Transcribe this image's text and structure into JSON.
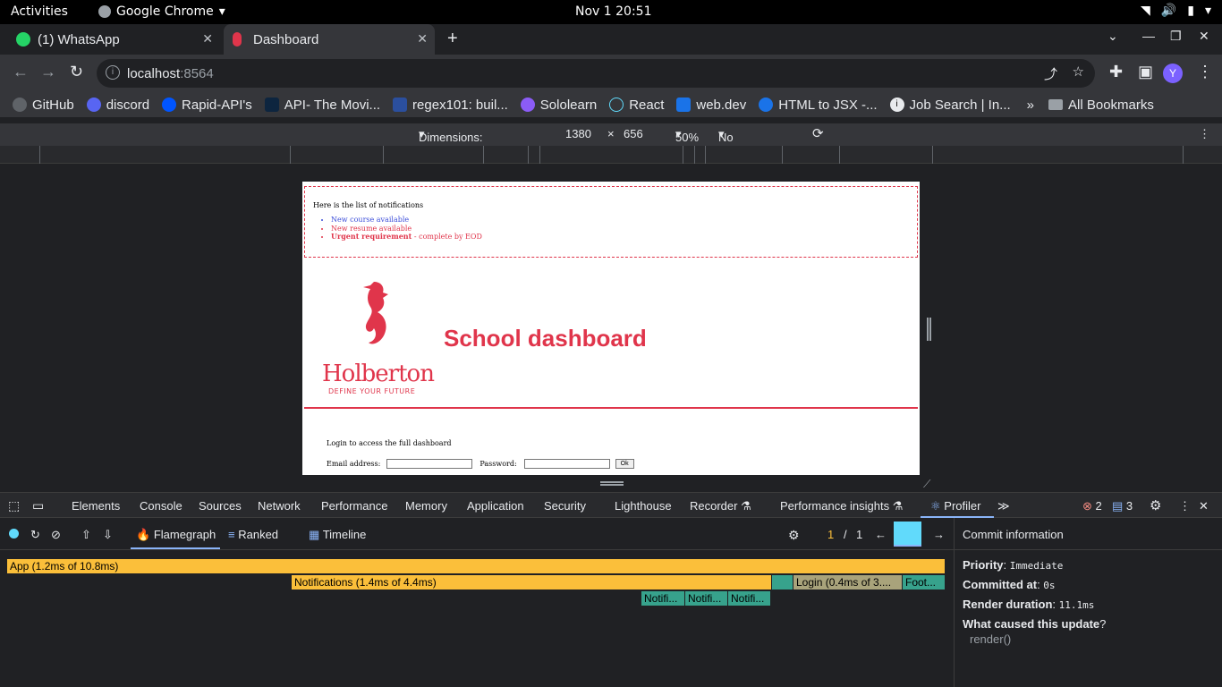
{
  "os": {
    "activities": "Activities",
    "app_name": "Google Chrome",
    "clock": "Nov 1  20:51"
  },
  "tabs": [
    {
      "label": "(1) WhatsApp"
    },
    {
      "label": "Dashboard"
    }
  ],
  "address": {
    "host": "localhost",
    "port": ":8564"
  },
  "bookmarks": [
    {
      "label": "GitHub",
      "icon": "github-icon"
    },
    {
      "label": "discord",
      "icon": "discord-icon"
    },
    {
      "label": "Rapid-API's",
      "icon": "rapidapi-icon"
    },
    {
      "label": "API- The Movi...",
      "icon": "tmdb-icon"
    },
    {
      "label": "regex101: buil...",
      "icon": "regex-icon"
    },
    {
      "label": "Sololearn",
      "icon": "sololearn-icon"
    },
    {
      "label": "React",
      "icon": "react-icon"
    },
    {
      "label": "web.dev",
      "icon": "webdev-icon"
    },
    {
      "label": "HTML to JSX -...",
      "icon": "transform-icon"
    },
    {
      "label": "Job Search | In...",
      "icon": "info-icon"
    }
  ],
  "all_bookmarks": "All Bookmarks",
  "device_toolbar": {
    "dimensions": "Dimensions: Responsive",
    "width": "1380",
    "times": "×",
    "height": "656",
    "zoom": "50%",
    "throttling": "No throttling"
  },
  "page": {
    "notif_heading": "Here is the list of notifications",
    "notifications": [
      {
        "text": "New course available",
        "type": "default"
      },
      {
        "text": "New resume available",
        "type": "urgent"
      },
      {
        "strong": "Urgent requirement",
        "text": " - complete by EOD",
        "type": "urgent"
      }
    ],
    "logo_word": "Holberton",
    "logo_tag": "DEFINE YOUR FUTURE",
    "title": "School dashboard",
    "login_text": "Login to access the full dashboard",
    "email_label": "Email address:",
    "password_label": "Password:",
    "ok": "Ok"
  },
  "devtools_tabs": [
    "Elements",
    "Console",
    "Sources",
    "Network",
    "Performance",
    "Memory",
    "Application",
    "Security",
    "Lighthouse",
    "Recorder",
    "Performance insights",
    "Profiler"
  ],
  "devtools_counts": {
    "errors": "2",
    "messages": "3"
  },
  "profiler": {
    "flamegraph": "Flamegraph",
    "ranked": "Ranked",
    "timeline": "Timeline",
    "commit_index": "1",
    "commit_sep": "/",
    "commit_total": "1",
    "bars": {
      "app": "App (1.2ms of 10.8ms)",
      "notifications": "Notifications (1.4ms of 4.4ms)",
      "login": "Login (0.4ms of 3....",
      "footer": "Foot...",
      "notif_item_1": "Notifi...",
      "notif_item_2": "Notifi...",
      "notif_item_3": "Notifi..."
    }
  },
  "commit_info": {
    "title": "Commit information",
    "priority_label": "Priority",
    "priority": "Immediate",
    "committed_label": "Committed at",
    "committed": "0s",
    "render_label": "Render duration",
    "render": "11.1ms",
    "cause_label": "What caused this update",
    "cause": "render()"
  },
  "colors": {
    "accent": "#e0354b",
    "react": "#61dafb",
    "flame_yellow": "#fbbf3a",
    "flame_green": "#37a28c"
  }
}
